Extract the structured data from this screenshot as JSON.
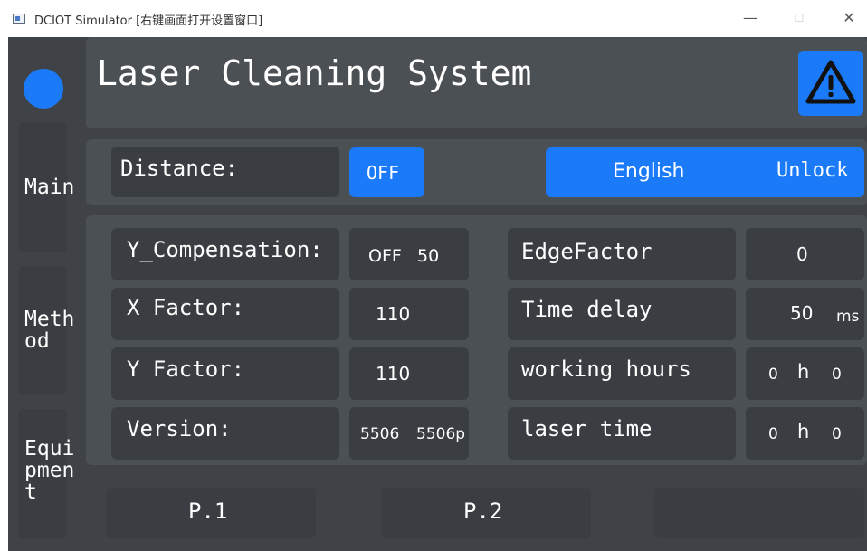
{
  "window": {
    "title": "DCIOT Simulator [右键画面打开设置窗口]",
    "minimize": "—",
    "maximize": "☐",
    "close": "✕"
  },
  "header": {
    "title": "Laser Cleaning System",
    "alarm_icon": "warning-triangle-icon"
  },
  "sidebar": {
    "items": [
      {
        "label": "Main"
      },
      {
        "label": "Meth\nod"
      },
      {
        "label": "Equi\npmen\nt"
      }
    ]
  },
  "distance": {
    "label": "Distance:",
    "toggle": "OFF"
  },
  "language_bar": {
    "language": "English",
    "lock": "Unlock"
  },
  "params": {
    "y_comp": {
      "label": "Y_Compensation:",
      "state": "OFF",
      "value": "50"
    },
    "x_factor": {
      "label": "X Factor:",
      "value": "110"
    },
    "y_factor": {
      "label": "Y Factor:",
      "value": "110"
    },
    "version": {
      "label": "Version:",
      "v1": "5506",
      "v2": "5506p"
    },
    "edge_factor": {
      "label": "EdgeFactor",
      "value": "0"
    },
    "time_delay": {
      "label": "Time delay",
      "value": "50",
      "unit": "ms"
    },
    "working_hours": {
      "label": "working hours",
      "hours": "0",
      "h": "h",
      "minutes": "0"
    },
    "laser_time": {
      "label": "laser time",
      "hours": "0",
      "h": "h",
      "minutes": "0"
    }
  },
  "footer": {
    "p1": "P.1",
    "p2": "P.2",
    "p3": ""
  },
  "colors": {
    "accent": "#1a7af8",
    "background": "#3f4347",
    "panel": "#4b5055",
    "cell": "#3a3e42"
  }
}
